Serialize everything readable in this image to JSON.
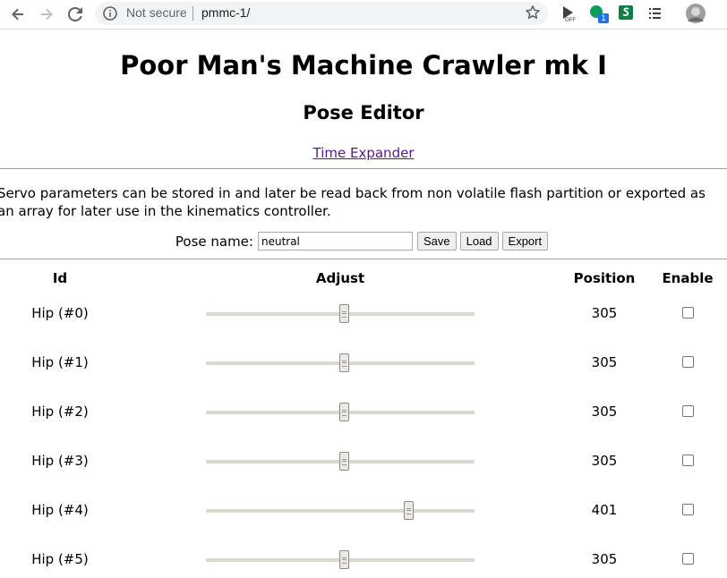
{
  "browser": {
    "security_label": "Not secure",
    "url": "pmmc-1/",
    "extension_badge": "1",
    "icons": [
      "back-icon",
      "forward-icon",
      "reload-icon",
      "info-icon",
      "star-icon",
      "extension-off-icon",
      "extension-green-icon",
      "extension-s-icon",
      "menu-list-icon",
      "profile-avatar"
    ]
  },
  "page": {
    "title": "Poor Man's Machine Crawler mk I",
    "subtitle": "Pose Editor",
    "link_label": "Time Expander",
    "description": "Servo parameters can be stored in and later be read back from non volatile flash partition or exported as an array for later use in the kinematics controller."
  },
  "pose": {
    "label": "Pose name:",
    "value": "neutral",
    "save_label": "Save",
    "load_label": "Load",
    "export_label": "Export"
  },
  "table": {
    "headers": {
      "id": "Id",
      "adjust": "Adjust",
      "position": "Position",
      "enable": "Enable"
    },
    "slider_range": [
      100,
      500
    ],
    "rows": [
      {
        "id": "Hip (#0)",
        "position": "305",
        "value": 305,
        "enabled": false
      },
      {
        "id": "Hip (#1)",
        "position": "305",
        "value": 305,
        "enabled": false
      },
      {
        "id": "Hip (#2)",
        "position": "305",
        "value": 305,
        "enabled": false
      },
      {
        "id": "Hip (#3)",
        "position": "305",
        "value": 305,
        "enabled": false
      },
      {
        "id": "Hip (#4)",
        "position": "401",
        "value": 401,
        "enabled": false
      },
      {
        "id": "Hip (#5)",
        "position": "305",
        "value": 305,
        "enabled": false
      }
    ]
  },
  "colors": {
    "link": "#551a8b",
    "badge": "#1a73e8"
  }
}
